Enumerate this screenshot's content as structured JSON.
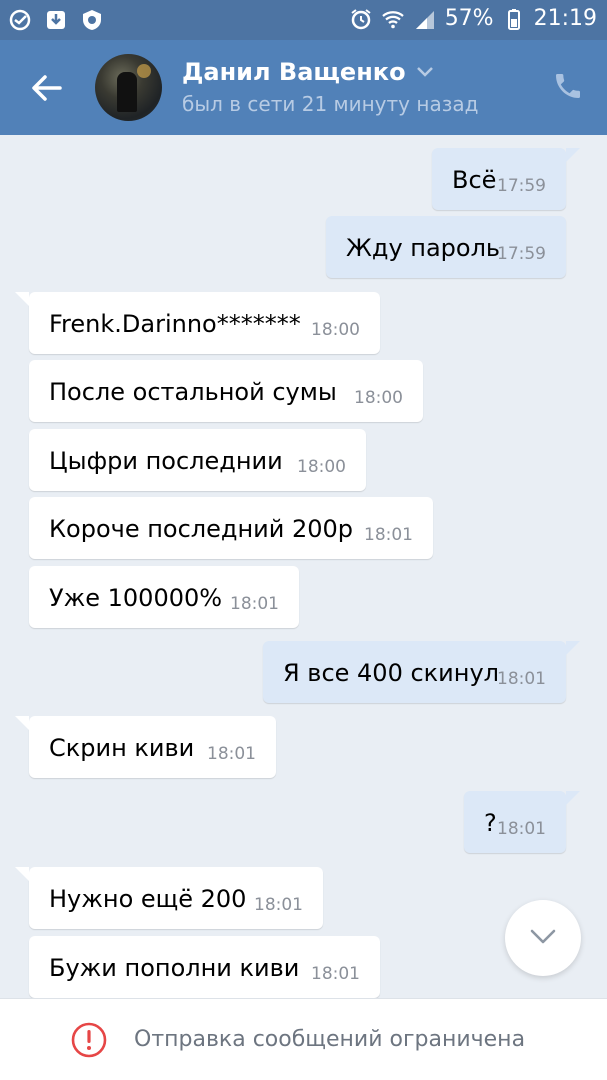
{
  "status_bar": {
    "battery": "57%",
    "time": "21:19"
  },
  "header": {
    "contact_name": "Данил Ващенко",
    "contact_status": "был в сети 21 минуту назад"
  },
  "messages": [
    {
      "dir": "out",
      "text": "Всё",
      "time": "17:59"
    },
    {
      "dir": "out",
      "text": "Жду пароль",
      "time": "17:59"
    },
    {
      "dir": "in",
      "text": "Frenk.Darinno*******",
      "time": "18:00"
    },
    {
      "dir": "in",
      "text": "После остальной сумы",
      "time": "18:00"
    },
    {
      "dir": "in",
      "text": "Цыфри последнии",
      "time": "18:00"
    },
    {
      "dir": "in",
      "text": "Короче последний 200р",
      "time": "18:01"
    },
    {
      "dir": "in",
      "text": "Уже 100000%",
      "time": "18:01"
    },
    {
      "dir": "out",
      "text": "Я все 400 скинул",
      "time": "18:01"
    },
    {
      "dir": "in",
      "text": "Скрин киви",
      "time": "18:01"
    },
    {
      "dir": "out",
      "text": "?",
      "time": "18:01"
    },
    {
      "dir": "in",
      "text": "Нужно ещё 200",
      "time": "18:01"
    },
    {
      "dir": "in",
      "text": "Бужи пополни киви",
      "time": "18:01"
    }
  ],
  "footer": {
    "notice": "Отправка сообщений ограничена"
  },
  "colors": {
    "header": "#5181b8",
    "status_bar": "#4d74a3",
    "chat_background": "#e9eef4",
    "outgoing_bubble": "#dce8f7",
    "incoming_bubble": "#ffffff",
    "warning": "#e64646"
  },
  "icons": {
    "back": "arrow-left-icon",
    "call": "phone-icon",
    "scroll": "chevron-down-icon",
    "warning": "exclamation-circle-icon"
  }
}
